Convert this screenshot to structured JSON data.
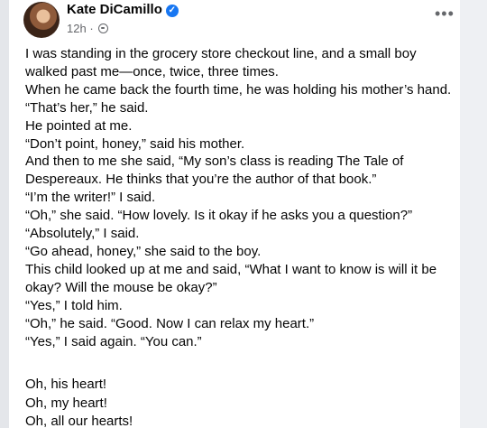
{
  "post": {
    "author": "Kate DiCamillo",
    "time": "12h",
    "dot": "·",
    "more_label": "•••",
    "verified_glyph": "✓",
    "paragraphs": [
      "I was standing in the grocery store checkout line, and a small boy walked past me—once, twice, three times.",
      "When he came back the fourth time, he was holding his mother’s hand.",
      "“That’s her,” he said.",
      "He pointed at me.",
      "“Don’t point, honey,” said his mother.",
      "And then to me she said, “My son’s class is reading The Tale of Despereaux.  He thinks that you’re the author of that book.”",
      "“I’m the writer!” I said.",
      "“Oh,” she said.  “How lovely.  Is it okay if he asks you a question?”",
      "“Absolutely,” I said.",
      "“Go ahead, honey,” she said to the boy.",
      "This child looked up at me and said, “What I want to know is will it be okay?  Will the mouse be okay?”",
      "“Yes,” I told him.",
      "“Oh,” he said.  “Good.  Now I can relax my heart.”",
      "“Yes,” I said again.  “You can.”"
    ],
    "coda": [
      "Oh, his heart!",
      "Oh, my heart!",
      "Oh, all our hearts!"
    ]
  },
  "icons": {
    "verified": "verified-badge-icon",
    "privacy": "globe-icon",
    "more": "more-options-icon"
  },
  "colors": {
    "verified_blue": "#1877f2",
    "secondary_text": "#65676b",
    "background": "#e4e6ea"
  }
}
